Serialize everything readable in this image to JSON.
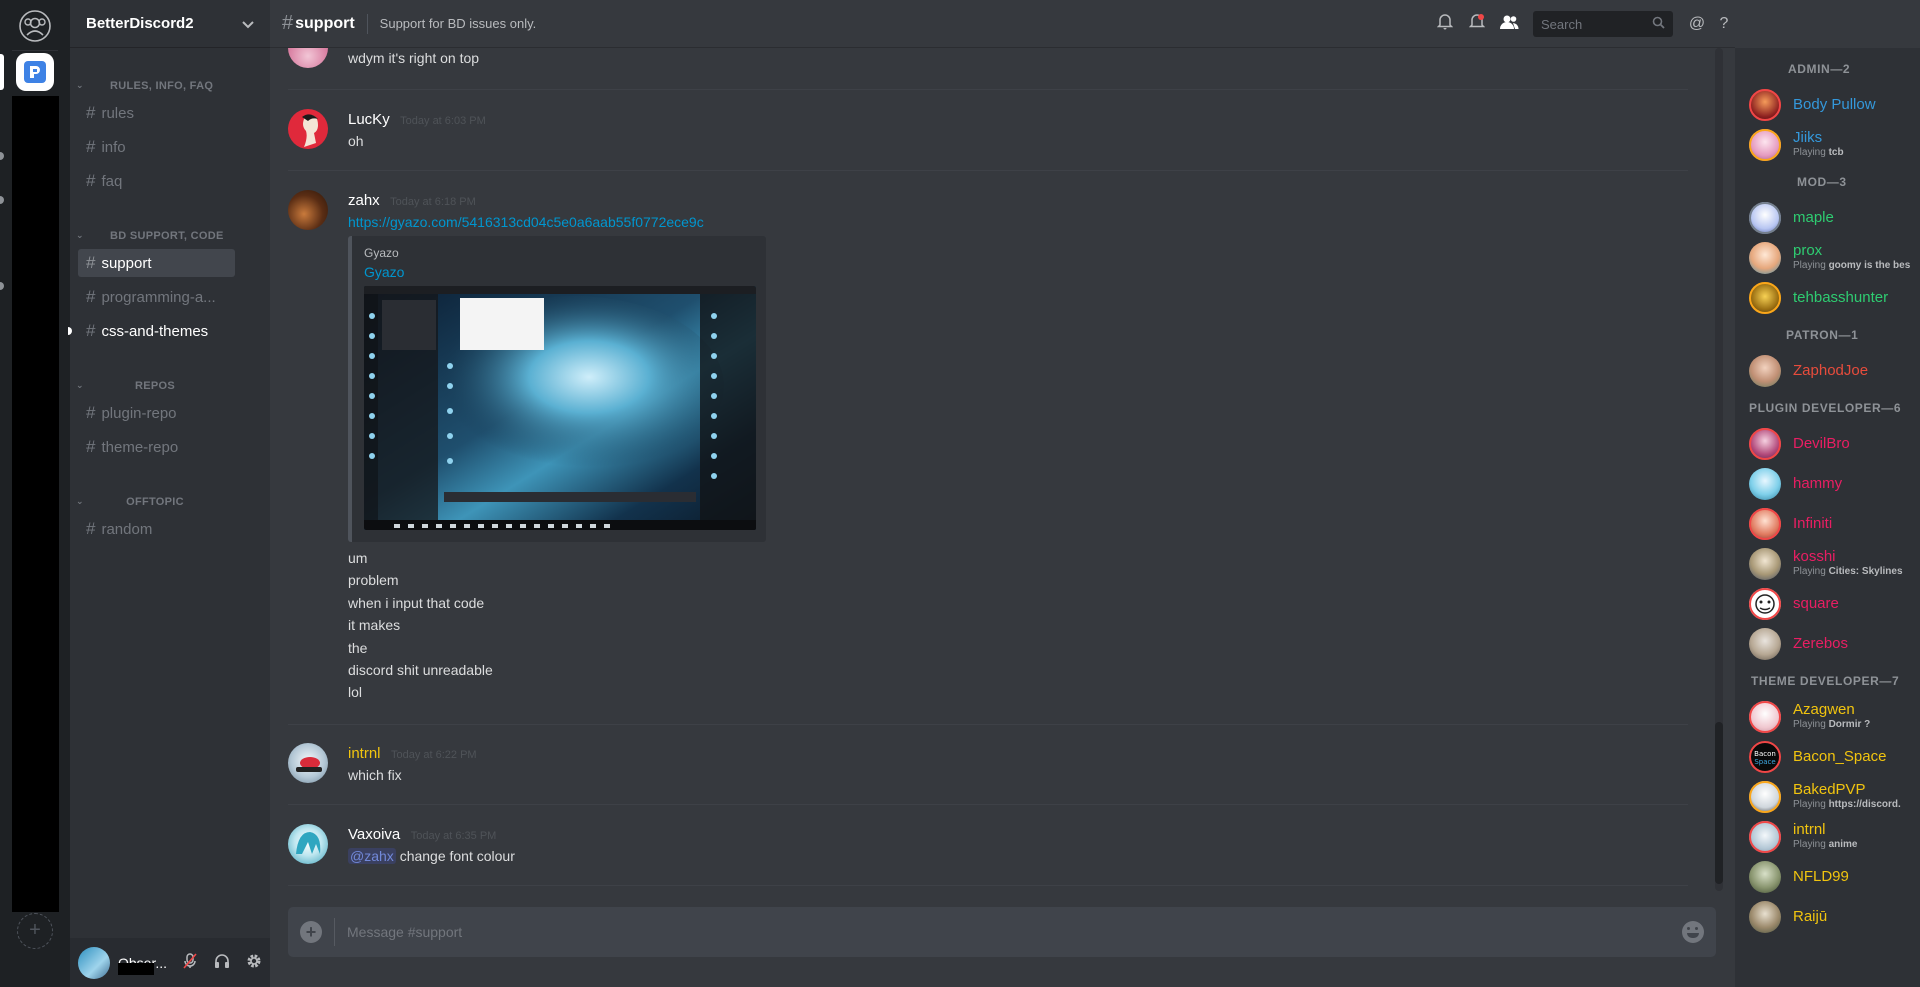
{
  "guild": {
    "name": "BetterDiscord2"
  },
  "channels": {
    "categories": [
      {
        "label": "RULES, INFO, FAQ"
      },
      {
        "label": "BD SUPPORT, CODE"
      },
      {
        "label": "REPOS"
      },
      {
        "label": "OFFTOPIC"
      }
    ],
    "items": [
      {
        "label": "rules"
      },
      {
        "label": "info"
      },
      {
        "label": "faq"
      },
      {
        "label": "support"
      },
      {
        "label": "programming-a..."
      },
      {
        "label": "css-and-themes"
      },
      {
        "label": "plugin-repo"
      },
      {
        "label": "theme-repo"
      },
      {
        "label": "random"
      }
    ]
  },
  "user": {
    "name": "Obser..."
  },
  "header": {
    "channel": "support",
    "topic": "Support for BD issues only.",
    "search_placeholder": "Search"
  },
  "messages": [
    {
      "lines": [
        "wdym it's right on top"
      ]
    },
    {
      "author": "LucKy",
      "author_color": "#ffffff",
      "timestamp": "Today at 6:03 PM",
      "lines": [
        "oh"
      ]
    },
    {
      "author": "zahx",
      "author_color": "#ffffff",
      "timestamp": "Today at 6:18 PM",
      "link": "https://gyazo.com/5416313cd04c5e0a6aab55f0772ece9c",
      "embed": {
        "provider": "Gyazo",
        "title": "Gyazo"
      },
      "lines": [
        "um",
        "problem",
        "when i input that code",
        "it makes",
        "the",
        "discord shit unreadable",
        "lol"
      ]
    },
    {
      "author": "intrnl",
      "author_color": "#f1c40f",
      "timestamp": "Today at 6:22 PM",
      "lines": [
        "which fix"
      ]
    },
    {
      "author": "Vaxoiva",
      "author_color": "#ffffff",
      "timestamp": "Today at 6:35 PM",
      "mention": "@zahx",
      "lines": [
        "change font colour"
      ]
    }
  ],
  "composer": {
    "placeholder": "Message #support"
  },
  "members": {
    "roles": [
      {
        "label": "ADMIN—2"
      },
      {
        "label": "MOD—3"
      },
      {
        "label": "PATRON—1"
      },
      {
        "label": "PLUGIN DEVELOPER—6"
      },
      {
        "label": "THEME DEVELOPER—7"
      }
    ],
    "list": [
      {
        "name": "Body Pullow",
        "color": "#3498db"
      },
      {
        "name": "Jiiks",
        "color": "#3498db",
        "activity_prefix": "Playing ",
        "activity": "tcb"
      },
      {
        "name": "maple",
        "color": "#2ecc71"
      },
      {
        "name": "prox",
        "color": "#2ecc71",
        "activity_prefix": "Playing ",
        "activity": "goomy is the bes"
      },
      {
        "name": "tehbasshunter",
        "color": "#2ecc71"
      },
      {
        "name": "ZaphodJoe",
        "color": "#e74c3c"
      },
      {
        "name": "DevilBro",
        "color": "#e91e63"
      },
      {
        "name": "hammy",
        "color": "#e91e63"
      },
      {
        "name": "Infiniti",
        "color": "#e91e63"
      },
      {
        "name": "kosshi",
        "color": "#e91e63",
        "activity_prefix": "Playing ",
        "activity": "Cities: Skylines"
      },
      {
        "name": "square",
        "color": "#e91e63"
      },
      {
        "name": "Zerebos",
        "color": "#e91e63"
      },
      {
        "name": "Azagwen",
        "color": "#f1c40f",
        "activity_prefix": "Playing ",
        "activity": "Dormir ?"
      },
      {
        "name": "Bacon_Space",
        "color": "#f1c40f"
      },
      {
        "name": "BakedPVP",
        "color": "#f1c40f",
        "activity_prefix": "Playing ",
        "activity": "https://discord."
      },
      {
        "name": "intrnl",
        "color": "#f1c40f",
        "activity_prefix": "Playing ",
        "activity": "anime"
      },
      {
        "name": "NFLD99",
        "color": "#f1c40f"
      },
      {
        "name": "Raijū",
        "color": "#f1c40f"
      }
    ]
  },
  "icons": {
    "friends": "friends-icon",
    "bell": "bell-icon",
    "pin": "pin-icon",
    "members": "members-icon",
    "search": "search-icon",
    "mention": "at-icon",
    "help": "help-icon",
    "mic": "mic-muted-icon",
    "headphones": "headphones-icon",
    "settings": "gear-icon"
  }
}
